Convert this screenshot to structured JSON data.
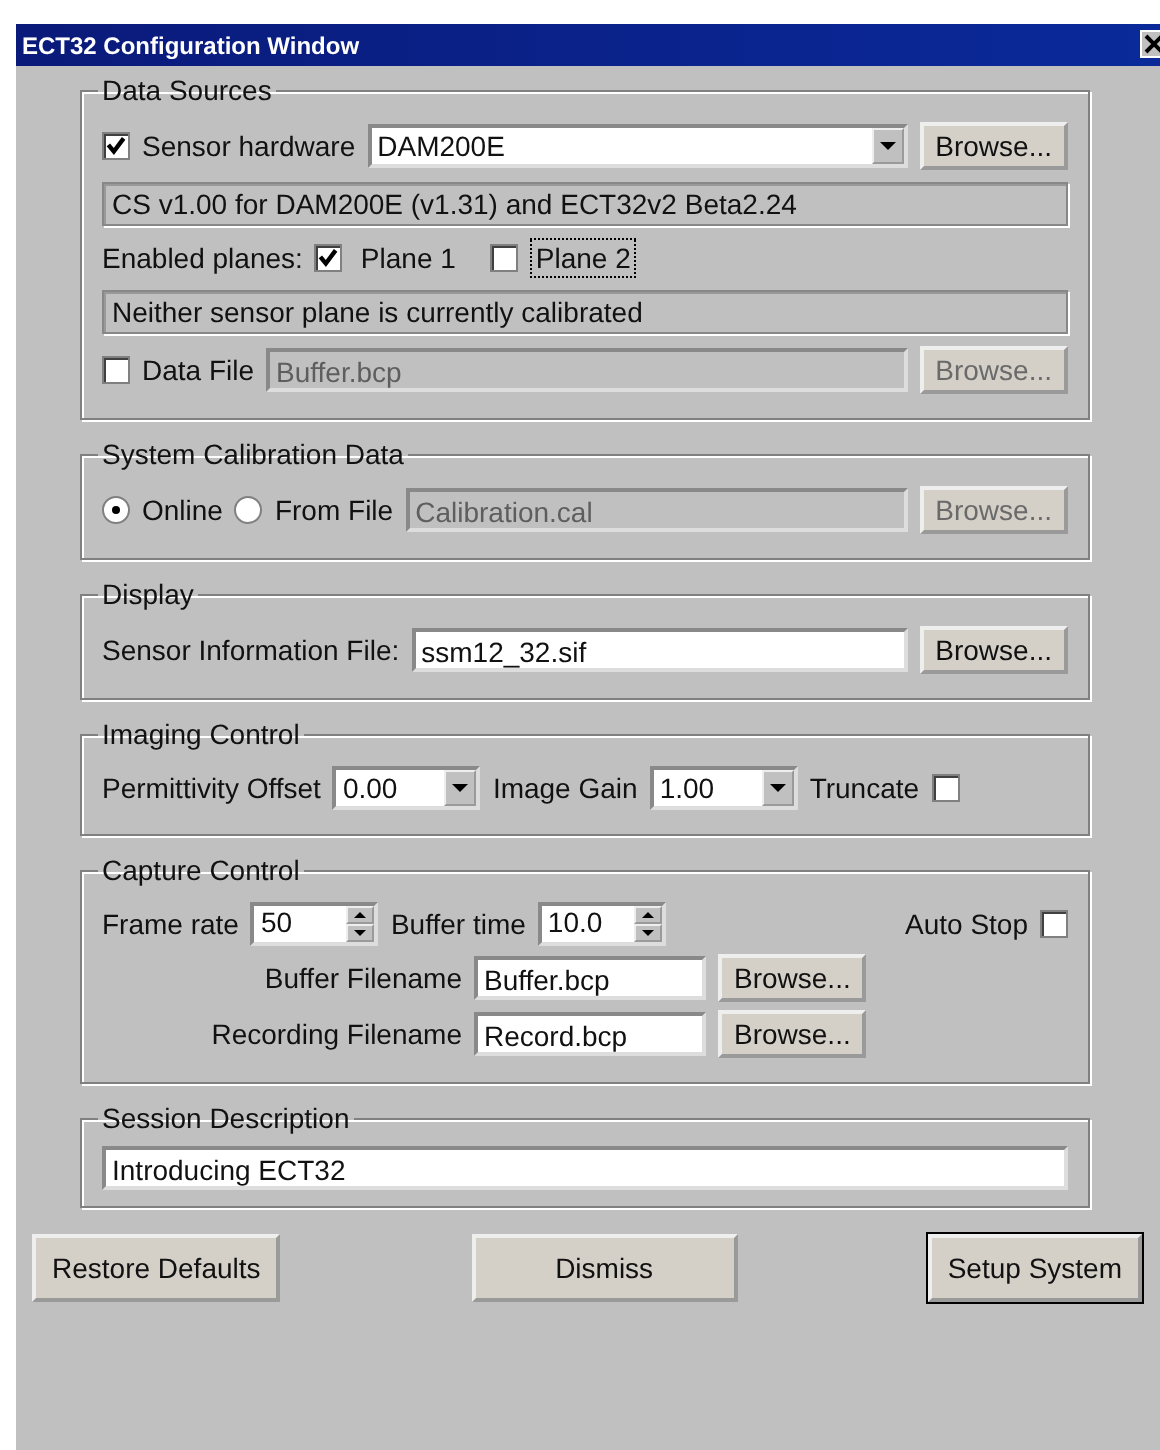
{
  "window": {
    "title": "ECT32 Configuration Window"
  },
  "data_sources": {
    "title": "Data Sources",
    "sensor_hardware": {
      "label": "Sensor hardware",
      "checked": true,
      "value": "DAM200E",
      "button": "Browse..."
    },
    "version_text": "CS v1.00 for DAM200E (v1.31) and ECT32v2 Beta2.24",
    "planes": {
      "label": "Enabled planes:",
      "items": [
        {
          "label": "Plane 1",
          "checked": true,
          "focused": false
        },
        {
          "label": "Plane 2",
          "checked": false,
          "focused": true
        }
      ]
    },
    "calibration_status": "Neither sensor plane is currently calibrated",
    "data_file": {
      "label": "Data File",
      "checked": false,
      "value": "Buffer.bcp",
      "button": "Browse...",
      "disabled": true
    }
  },
  "system_calibration": {
    "title": "System Calibration Data",
    "options": [
      {
        "label": "Online",
        "selected": true
      },
      {
        "label": "From File",
        "selected": false
      }
    ],
    "file": {
      "value": "Calibration.cal",
      "button": "Browse...",
      "disabled": true
    }
  },
  "display": {
    "title": "Display",
    "label": "Sensor Information File:",
    "value": "ssm12_32.sif",
    "button": "Browse..."
  },
  "imaging": {
    "title": "Imaging Control",
    "fields": [
      {
        "label": "Permittivity Offset",
        "value": "0.00"
      },
      {
        "label": "Image Gain",
        "value": "1.00"
      }
    ],
    "truncate": {
      "label": "Truncate",
      "checked": false
    }
  },
  "capture": {
    "title": "Capture Control",
    "spinners": [
      {
        "label": "Frame rate",
        "value": "50"
      },
      {
        "label": "Buffer time",
        "value": "10.0"
      }
    ],
    "auto_stop": {
      "label": "Auto Stop",
      "checked": false
    },
    "files": [
      {
        "label": "Buffer Filename",
        "value": "Buffer.bcp",
        "button": "Browse..."
      },
      {
        "label": "Recording Filename",
        "value": "Record.bcp",
        "button": "Browse..."
      }
    ]
  },
  "session": {
    "title": "Session Description",
    "value": "Introducing ECT32"
  },
  "buttons": [
    {
      "label": "Restore Defaults",
      "default": false
    },
    {
      "label": "Dismiss",
      "default": false
    },
    {
      "label": "Setup System",
      "default": true
    }
  ]
}
